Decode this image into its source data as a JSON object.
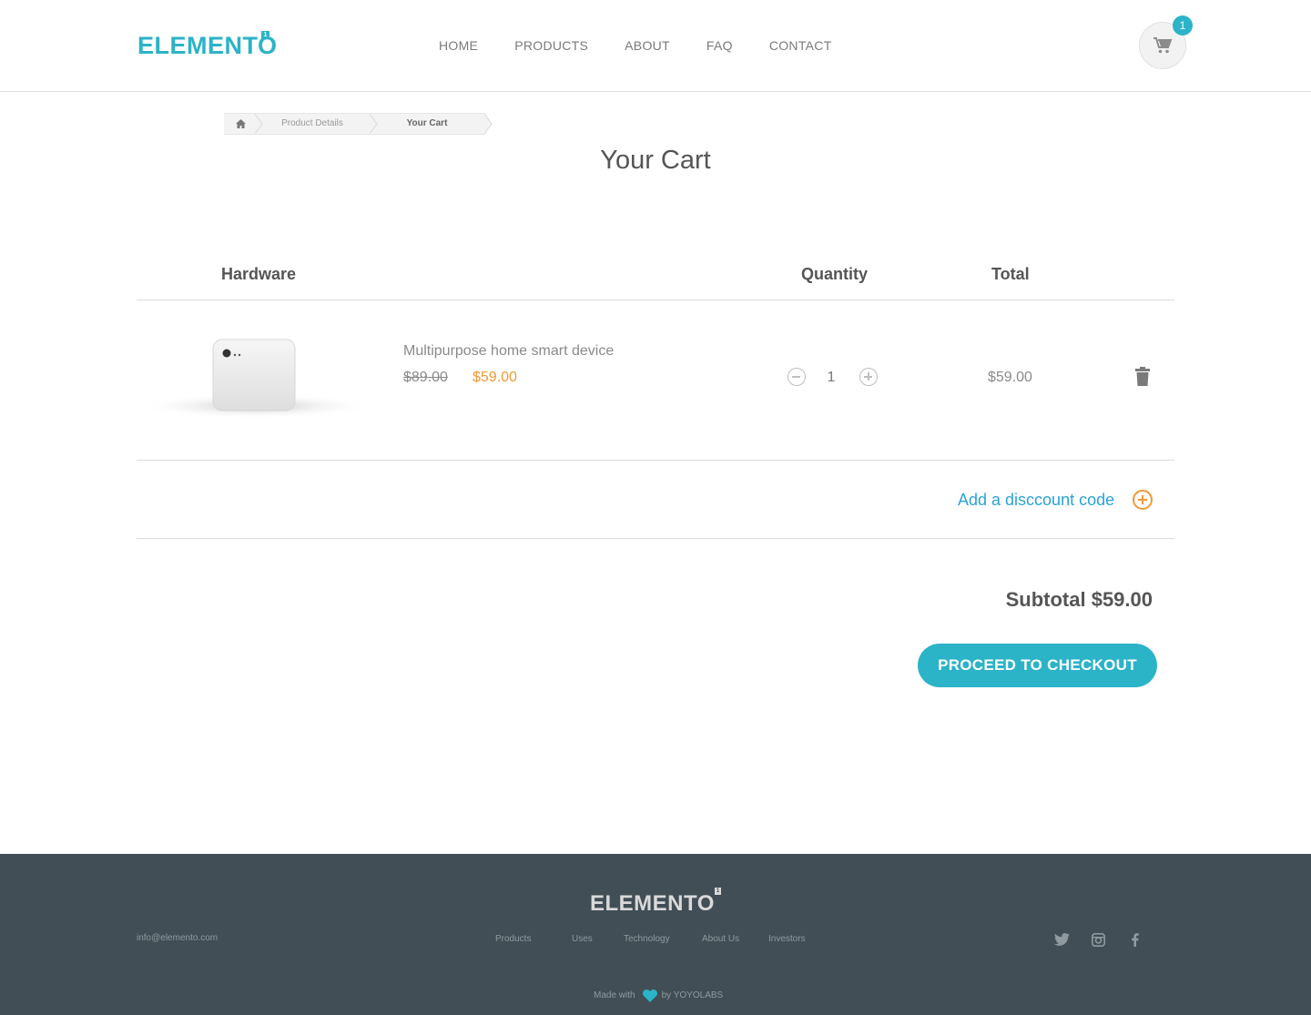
{
  "header": {
    "logo": "ELEMENTO",
    "logo_sup": "1",
    "nav": [
      "HOME",
      "PRODUCTS",
      "ABOUT",
      "FAQ",
      "CONTACT"
    ],
    "cart_count": "1"
  },
  "breadcrumb": {
    "items": [
      "Product Details",
      "Your Cart"
    ]
  },
  "page_title": "Your Cart",
  "table": {
    "headers": {
      "hardware": "Hardware",
      "quantity": "Quantity",
      "total": "Total"
    },
    "item": {
      "name": "Multipurpose home smart device",
      "old_price": "$89.00",
      "price": "$59.00",
      "quantity": "1",
      "total": "$59.00"
    }
  },
  "discount": {
    "label": "Add a disccount code"
  },
  "summary": {
    "subtotal": "Subtotal $59.00",
    "checkout_label": "PROCEED TO CHECKOUT"
  },
  "footer": {
    "logo": "ELEMENTO",
    "logo_sup": "1",
    "email": "info@elemento.com",
    "links": [
      "Products",
      "Uses",
      "Technology",
      "About Us",
      "Investors"
    ],
    "made_with": "Made with",
    "by": "by YOYOLABS"
  },
  "colors": {
    "accent": "#2bb3c8",
    "price": "#f09a36",
    "link": "#2ba3d6",
    "footer_bg": "#414e55"
  },
  "icons": [
    "cart-icon",
    "home-icon",
    "trash-icon",
    "heart-icon",
    "twitter-icon",
    "instagram-icon",
    "facebook-icon"
  ]
}
